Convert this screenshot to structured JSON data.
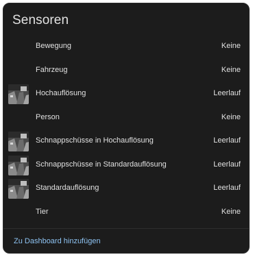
{
  "card": {
    "title": "Sensoren"
  },
  "entities": [
    {
      "name": "Bewegung",
      "state": "Keine",
      "thumbnail": false
    },
    {
      "name": "Fahrzeug",
      "state": "Keine",
      "thumbnail": false
    },
    {
      "name": "Hochauflösung",
      "state": "Leerlauf",
      "thumbnail": true
    },
    {
      "name": "Person",
      "state": "Keine",
      "thumbnail": false
    },
    {
      "name": "Schnappschüsse in Hochauflösung",
      "state": "Leerlauf",
      "thumbnail": true
    },
    {
      "name": "Schnappschüsse in Standardauflösung",
      "state": "Leerlauf",
      "thumbnail": true
    },
    {
      "name": "Standardauflösung",
      "state": "Leerlauf",
      "thumbnail": true
    },
    {
      "name": "Tier",
      "state": "Keine",
      "thumbnail": false
    }
  ],
  "footer": {
    "action_label": "Zu Dashboard hinzufügen"
  },
  "colors": {
    "card_background": "#1c1c1c",
    "text_primary": "#e1e1e1",
    "link": "#8ec3f2",
    "divider": "#2e2e2e"
  },
  "icons": {
    "thumbnail": "camera-snapshot-thumbnail"
  }
}
